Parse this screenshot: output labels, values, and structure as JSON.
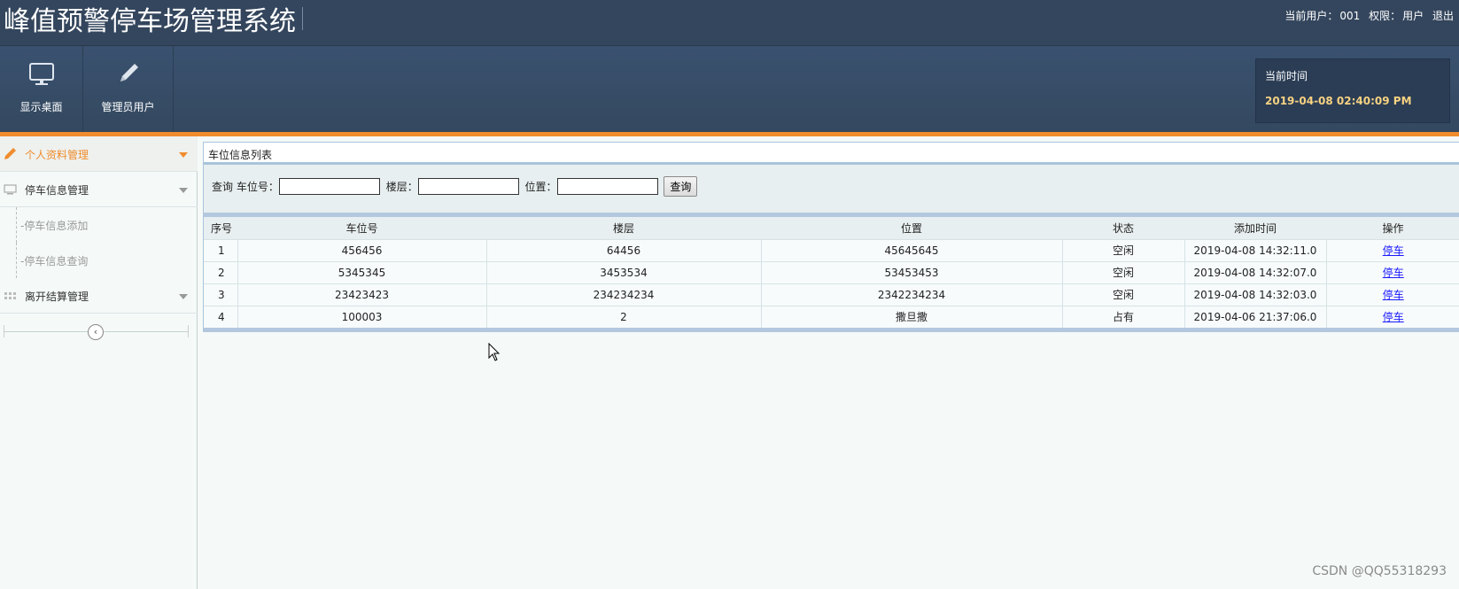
{
  "header": {
    "title": "峰值预警停车场管理系统",
    "current_user_label": "当前用户：",
    "current_user_value": "001",
    "role_label": "权限：",
    "role_value": "用户",
    "logout_label": "退出"
  },
  "nav": {
    "items": [
      {
        "label": "显示桌面",
        "icon": "monitor-icon"
      },
      {
        "label": "管理员用户",
        "icon": "pencil-icon"
      }
    ],
    "time_label": "当前时间",
    "time_value": "2019-04-08 02:40:09 PM"
  },
  "sidebar": {
    "menus": [
      {
        "label": "个人资料管理",
        "icon": "pencil-icon",
        "active": true
      },
      {
        "label": "停车信息管理",
        "icon": "monitor-icon",
        "active": false,
        "children": [
          "停车信息添加",
          "停车信息查询"
        ]
      },
      {
        "label": "离开结算管理",
        "icon": "grid-icon",
        "active": false
      }
    ],
    "collapse_icon": "chevron-left-icon"
  },
  "panel": {
    "title": "车位信息列表",
    "search": {
      "prefix": "查询",
      "spot_label": "车位号：",
      "floor_label": "楼层：",
      "location_label": "位置：",
      "button_label": "查询"
    },
    "table": {
      "headers": [
        "序号",
        "车位号",
        "楼层",
        "位置",
        "状态",
        "添加时间",
        "操作"
      ],
      "rows": [
        [
          "1",
          "456456",
          "64456",
          "45645645",
          "空闲",
          "2019-04-08 14:32:11.0",
          "停车"
        ],
        [
          "2",
          "5345345",
          "3453534",
          "53453453",
          "空闲",
          "2019-04-08 14:32:07.0",
          "停车"
        ],
        [
          "3",
          "23423423",
          "234234234",
          "2342234234",
          "空闲",
          "2019-04-08 14:32:03.0",
          "停车"
        ],
        [
          "4",
          "100003",
          "2",
          "撒旦撒",
          "占有",
          "2019-04-06 21:37:06.0",
          "停车"
        ]
      ]
    }
  },
  "watermark": "CSDN @QQ55318293",
  "colors": {
    "header_bg": "#34465d",
    "accent_orange": "#f08c2d",
    "time_text": "#f7d281",
    "link": "#1a1aff"
  }
}
